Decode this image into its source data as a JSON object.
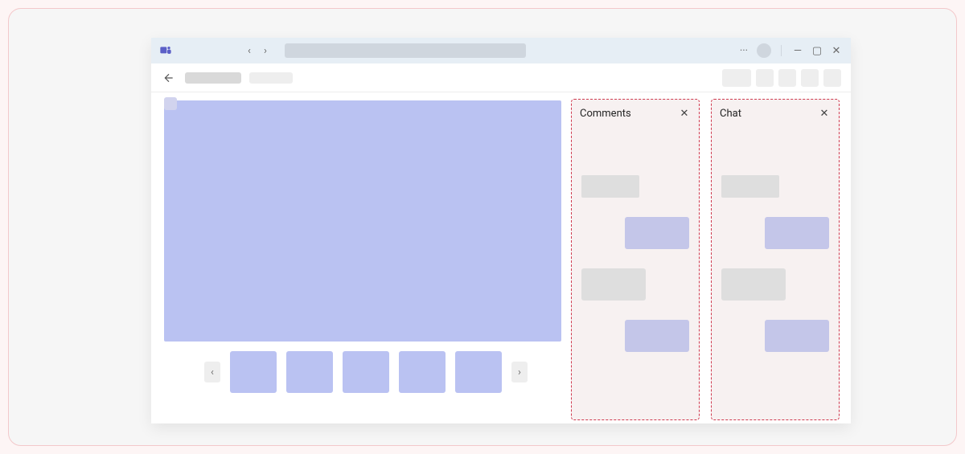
{
  "titlebar": {
    "app_icon": "teams-icon",
    "nav_back": "‹",
    "nav_fwd": "›",
    "ellipsis": "···",
    "window_controls": {
      "min": "—",
      "max": "▢",
      "close": "✕"
    }
  },
  "toolbar": {
    "back_glyph": "←"
  },
  "thumbnails": {
    "prev": "‹",
    "next": "›",
    "count": 5
  },
  "panels": {
    "comments": {
      "title": "Comments",
      "close": "✕"
    },
    "chat": {
      "title": "Chat",
      "close": "✕"
    }
  }
}
